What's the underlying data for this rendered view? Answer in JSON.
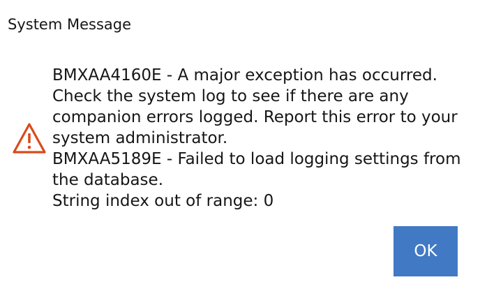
{
  "dialog": {
    "title": "System Message",
    "icon": "warning-triangle-icon",
    "message_lines": [
      "BMXAA4160E - A major exception has occurred.",
      "Check the system log to see if there are any",
      "companion errors logged. Report this error to your",
      "system administrator.",
      "BMXAA5189E - Failed to load logging settings from",
      "the database.",
      "String index out of range: 0"
    ],
    "ok_label": "OK"
  },
  "colors": {
    "warning": "#da4a1a",
    "button": "#4179c4",
    "text": "#161616"
  }
}
